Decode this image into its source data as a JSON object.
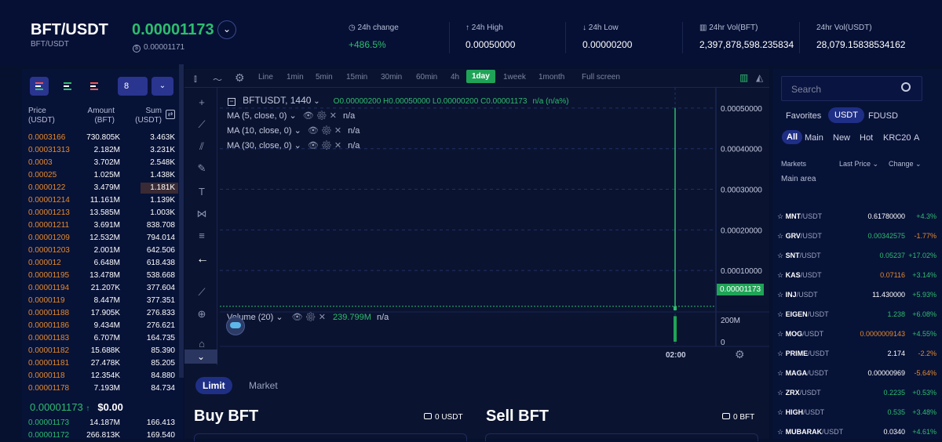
{
  "header": {
    "pair": "BFT/USDT",
    "pair_sub": "BFT/USDT",
    "last_price": "0.00001173",
    "price_sub_icon": "$",
    "price_sub": "0.00001171",
    "toggle_icon": "chevron-down-icon",
    "stats": [
      {
        "label": "24h change",
        "icon": "clock-icon",
        "icon_glyph": "◷",
        "value": "+486.5%",
        "color": "#2ebd6e"
      },
      {
        "label": "24h High",
        "icon": "arrow-up-icon",
        "icon_glyph": "↑",
        "value": "0.00050000",
        "color": "#ffffff"
      },
      {
        "label": "24h Low",
        "icon": "arrow-down-icon",
        "icon_glyph": "↓",
        "value": "0.00000200",
        "color": "#ffffff"
      },
      {
        "label": "24hr Vol(BFT)",
        "icon": "volume-icon",
        "icon_glyph": "▥",
        "value": "2,397,878,598.235834",
        "color": "#ffffff"
      },
      {
        "label": "24hr Vol(USDT)",
        "icon": "",
        "icon_glyph": "",
        "value": "28,079.15838534162",
        "color": "#ffffff"
      }
    ]
  },
  "orderbook": {
    "depth_value": "8",
    "headers": {
      "price": "Price",
      "price_unit": "(USDT)",
      "amount": "Amount",
      "amount_unit": "(BFT)",
      "sum": "Sum",
      "sum_unit": "(USDT)"
    },
    "asks": [
      {
        "price": "0.0003166",
        "amount": "730.805K",
        "sum": "3.463K"
      },
      {
        "price": "0.00031313",
        "amount": "2.182M",
        "sum": "3.231K"
      },
      {
        "price": "0.0003",
        "amount": "3.702M",
        "sum": "2.548K"
      },
      {
        "price": "0.00025",
        "amount": "1.025M",
        "sum": "1.438K"
      },
      {
        "price": "0.0000122",
        "amount": "3.479M",
        "sum": "1.181K"
      },
      {
        "price": "0.00001214",
        "amount": "11.161M",
        "sum": "1.139K"
      },
      {
        "price": "0.00001213",
        "amount": "13.585M",
        "sum": "1.003K"
      },
      {
        "price": "0.00001211",
        "amount": "3.691M",
        "sum": "838.708"
      },
      {
        "price": "0.00001209",
        "amount": "12.532M",
        "sum": "794.014"
      },
      {
        "price": "0.00001203",
        "amount": "2.001M",
        "sum": "642.506"
      },
      {
        "price": "0.000012",
        "amount": "6.648M",
        "sum": "618.438"
      },
      {
        "price": "0.00001195",
        "amount": "13.478M",
        "sum": "538.668"
      },
      {
        "price": "0.00001194",
        "amount": "21.207K",
        "sum": "377.604"
      },
      {
        "price": "0.0000119",
        "amount": "8.447M",
        "sum": "377.351"
      },
      {
        "price": "0.00001188",
        "amount": "17.905K",
        "sum": "276.833"
      },
      {
        "price": "0.00001186",
        "amount": "9.434M",
        "sum": "276.621"
      },
      {
        "price": "0.00001183",
        "amount": "6.707M",
        "sum": "164.735"
      },
      {
        "price": "0.00001182",
        "amount": "15.688K",
        "sum": "85.390"
      },
      {
        "price": "0.00001181",
        "amount": "27.478K",
        "sum": "85.205"
      },
      {
        "price": "0.0000118",
        "amount": "12.354K",
        "sum": "84.880"
      },
      {
        "price": "0.00001178",
        "amount": "7.193M",
        "sum": "84.734"
      }
    ],
    "last": {
      "price": "0.00001173",
      "arrow": "↑",
      "usd": "$0.00"
    },
    "bids": [
      {
        "price": "0.00001173",
        "amount": "14.187M",
        "sum": "166.413"
      },
      {
        "price": "0.00001172",
        "amount": "266.813K",
        "sum": "169.540"
      }
    ]
  },
  "chart_toolbar": {
    "items": [
      "Line",
      "1min",
      "5min",
      "15min",
      "30min",
      "60min",
      "4h",
      "1day",
      "1week",
      "1month",
      "Full screen"
    ],
    "active": "1day"
  },
  "chart_legend": {
    "symbol": "BFTUSDT, 1440",
    "ohlc": "O0.00000200 H0.00050000 L0.00000200 C0.00001173",
    "change": "n/a (n/a%)",
    "ma": [
      "MA (5, close, 0)",
      "MA (10, close, 0)",
      "MA (30, close, 0)"
    ],
    "ma_value": "n/a",
    "volume_label": "Volume (20)",
    "volume_value": "239.799M",
    "volume_extra": "n/a"
  },
  "chart_data": {
    "type": "line",
    "yticks": [
      "0.00050000",
      "0.00040000",
      "0.00030000",
      "0.00020000",
      "0.00010000"
    ],
    "ylim": [
      0,
      0.00055
    ],
    "xticks": [
      "02:00"
    ],
    "candles": [
      {
        "open": 2e-06,
        "high": 0.0005,
        "low": 2e-06,
        "close": 1.173e-05
      }
    ],
    "last_price_label": "0.00001173",
    "volume_ticks": [
      "200M",
      "0"
    ],
    "volume": [
      239799000
    ]
  },
  "order_form": {
    "tabs": [
      "Limit",
      "Market"
    ],
    "buy_title": "Buy BFT",
    "buy_balance": "0 USDT",
    "sell_title": "Sell BFT",
    "sell_balance": "0 BFT"
  },
  "markets": {
    "search_placeholder": "Search",
    "quote_tabs": [
      "Favorites",
      "USDT",
      "FDUSD"
    ],
    "quote_active": "USDT",
    "category_tabs": [
      "All",
      "Main",
      "New",
      "Hot",
      "KRC20",
      "A"
    ],
    "category_active": "All",
    "headers": {
      "market": "Markets",
      "last": "Last Price",
      "change": "Change"
    },
    "section": "Main area",
    "rows": [
      {
        "base": "MNT",
        "quote": "/USDT",
        "price": "0.61780000",
        "change": "+4.3%",
        "dir": "flat",
        "cdir": "up"
      },
      {
        "base": "GRV",
        "quote": "/USDT",
        "price": "0.00342575",
        "change": "-1.77%",
        "dir": "up",
        "cdir": "down"
      },
      {
        "base": "SNT",
        "quote": "/USDT",
        "price": "0.05237",
        "change": "+17.02%",
        "dir": "up",
        "cdir": "up"
      },
      {
        "base": "KAS",
        "quote": "/USDT",
        "price": "0.07116",
        "change": "+3.14%",
        "dir": "down",
        "cdir": "up"
      },
      {
        "base": "INJ",
        "quote": "/USDT",
        "price": "11.430000",
        "change": "+5.93%",
        "dir": "flat",
        "cdir": "up"
      },
      {
        "base": "EIGEN",
        "quote": "/USDT",
        "price": "1.238",
        "change": "+6.08%",
        "dir": "up",
        "cdir": "up"
      },
      {
        "base": "MOG",
        "quote": "/USDT",
        "price": "0.0000009143",
        "change": "+4.55%",
        "dir": "down",
        "cdir": "up"
      },
      {
        "base": "PRIME",
        "quote": "/USDT",
        "price": "2.174",
        "change": "-2.2%",
        "dir": "flat",
        "cdir": "down"
      },
      {
        "base": "MAGA",
        "quote": "/USDT",
        "price": "0.00000969",
        "change": "-5.64%",
        "dir": "flat",
        "cdir": "down"
      },
      {
        "base": "ZRX",
        "quote": "/USDT",
        "price": "0.2235",
        "change": "+0.53%",
        "dir": "up",
        "cdir": "up"
      },
      {
        "base": "HIGH",
        "quote": "/USDT",
        "price": "0.535",
        "change": "+3.48%",
        "dir": "up",
        "cdir": "up"
      },
      {
        "base": "MUBARAK",
        "quote": "/USDT",
        "price": "0.0340",
        "change": "+4.61%",
        "dir": "flat",
        "cdir": "up"
      }
    ]
  },
  "colors": {
    "green": "#2ebd6e",
    "orange": "#e58a2c",
    "accent": "#1f2f86",
    "bg": "#06102f"
  }
}
